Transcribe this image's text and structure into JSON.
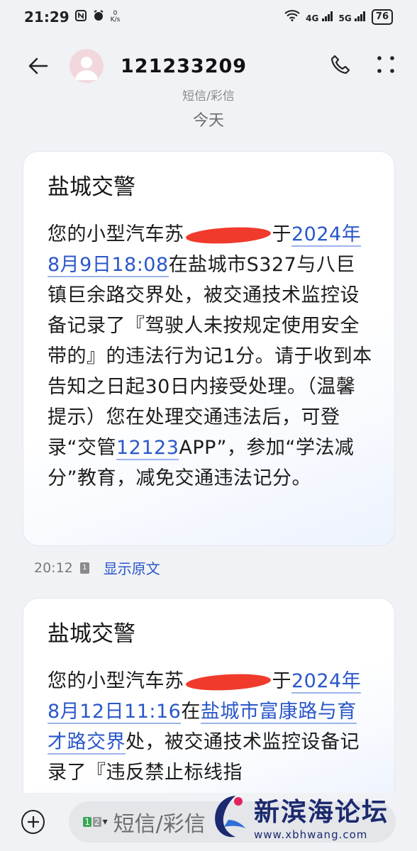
{
  "status_bar": {
    "time": "21:29",
    "speed_value": "0",
    "speed_unit": "K/s",
    "network_1": "4G",
    "network_2": "5G",
    "battery": "76"
  },
  "header": {
    "title": "121233209"
  },
  "sub_label": "短信/彩信",
  "date_label": "今天",
  "messages": [
    {
      "sender": "盐城交警",
      "text_a": "您的小型汽车苏",
      "text_b": "于",
      "link_1": "2024年8月9日18:08",
      "text_c": "在盐城市S327与八巨镇巨余路交界处，被交通技术监控设备记录了『驾驶人未按规定使用安全带的』的违法行为记1分。请于收到本告知之日起30日内接受处理。（温馨提示）您在处理交通违法后，可登录“交管",
      "link_2": "12123",
      "text_d": "APP”，参加“学法减分”教育，减免交通违法记分。",
      "time": "20:12",
      "sim": "1",
      "action": "显示原文"
    },
    {
      "sender": "盐城交警",
      "text_a": "您的小型汽车苏",
      "text_b": "于",
      "link_1": "2024年8月12日11:16",
      "text_c": "在",
      "link_2": "盐城市富康路与育才路交界",
      "text_d": "处，被交通技术监控设备记录了『违反禁止标线指"
    }
  ],
  "composer": {
    "sim_primary": "1",
    "sim_secondary": "2",
    "placeholder": "短信/彩信"
  },
  "watermark": {
    "name": "新滨海论坛",
    "url": "www.xbhwang.com"
  },
  "colors": {
    "link": "#2a57c9",
    "redaction": "#f03a2c",
    "background": "#f1f2f5"
  }
}
